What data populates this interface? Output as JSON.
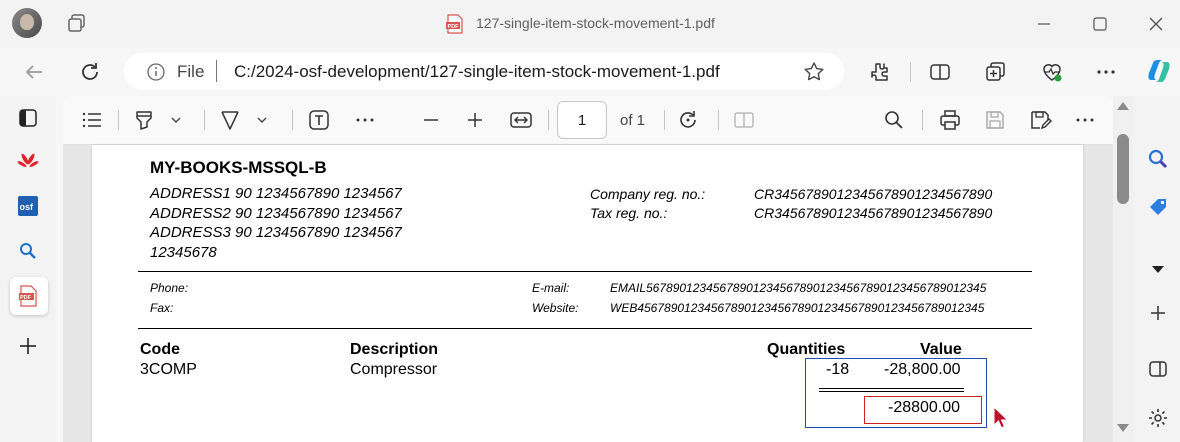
{
  "window": {
    "tab_title": "127-single-item-stock-movement-1.pdf"
  },
  "address_bar": {
    "scheme_label": "File",
    "url": "C:/2024-osf-development/127-single-item-stock-movement-1.pdf"
  },
  "pdf_toolbar": {
    "page_number": "1",
    "page_total": "of 1"
  },
  "document": {
    "company_name": "MY-BOOKS-MSSQL-B",
    "address_lines": [
      "ADDRESS1 90 1234567890 1234567",
      "ADDRESS2 90 1234567890 1234567",
      "ADDRESS3 90 1234567890 1234567",
      "12345678"
    ],
    "company_reg_label": "Company reg. no.:",
    "company_reg_value": "CR3456789012345678901234567890",
    "tax_reg_label": "Tax reg. no.:",
    "tax_reg_value": "CR3456789012345678901234567890",
    "phone_label": "Phone:",
    "fax_label": "Fax:",
    "email_label": "E-mail:",
    "email_value": "EMAIL567890123456789012345678901234567890123456789012345",
    "website_label": "Website:",
    "website_value": "WEB4567890123456789012345678901234567890123456789012345",
    "table": {
      "headers": {
        "code": "Code",
        "description": "Description",
        "quantities": "Quantities",
        "value": "Value"
      },
      "row": {
        "code": "3COMP",
        "description": "Compressor",
        "quantity": "-18",
        "value": "-28,800.00"
      },
      "total": "-28800.00"
    }
  },
  "colors": {
    "selection_blue": "#1f4fb0",
    "highlight_red": "#cc2222"
  }
}
